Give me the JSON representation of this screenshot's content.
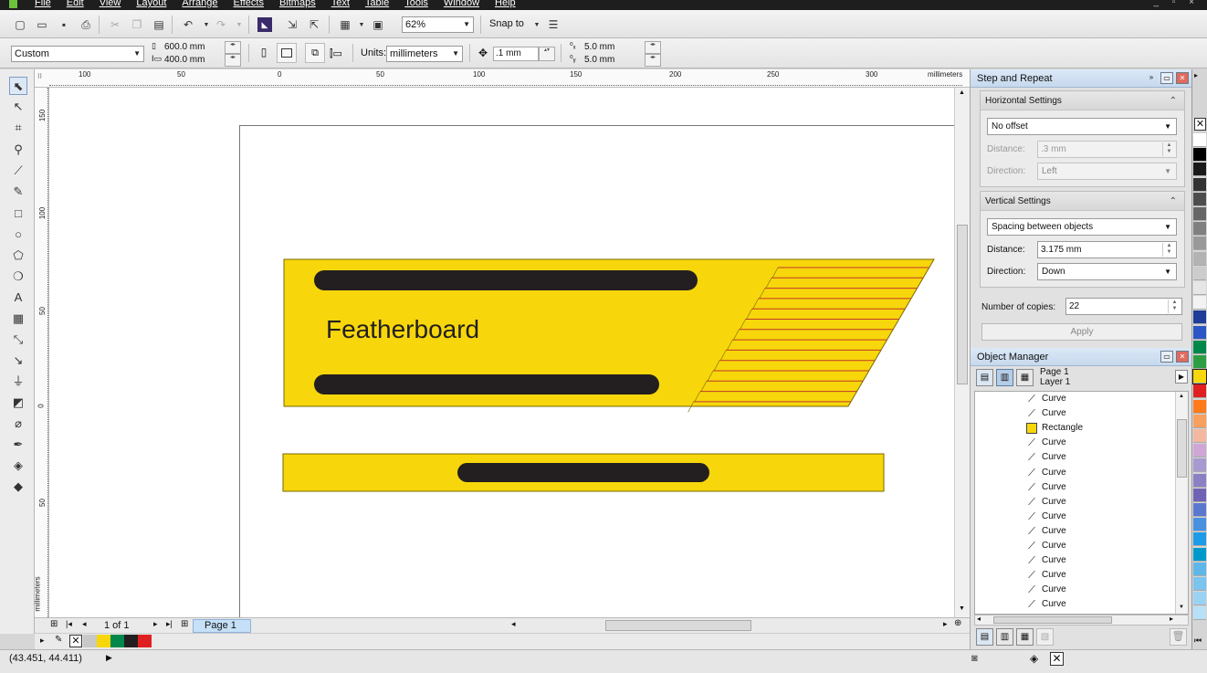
{
  "menu": {
    "items": [
      "File",
      "Edit",
      "View",
      "Layout",
      "Arrange",
      "Effects",
      "Bitmaps",
      "Text",
      "Table",
      "Tools",
      "Window",
      "Help"
    ],
    "window_controls": "_ ▫ ×"
  },
  "toolbar": {
    "zoom_value": "62%",
    "snap_to_label": "Snap to"
  },
  "propbar": {
    "page_preset": "Custom",
    "page_width": "600.0 mm",
    "page_height": "400.0 mm",
    "units_label": "Units:",
    "units_value": "millimeters",
    "nudge_value": ".1 mm",
    "dup_x": "5.0 mm",
    "dup_y": "5.0 mm"
  },
  "rulers": {
    "h_labels": [
      "100",
      "50",
      "0",
      "50",
      "100",
      "150",
      "200",
      "250",
      "300",
      "millimeters"
    ],
    "v_labels": [
      "150",
      "100",
      "50",
      "0",
      "50",
      "millimeters"
    ]
  },
  "drawing": {
    "title_text": "Featherboard",
    "fill_color": "#f7d70b",
    "bar_color": "#231f20",
    "line_color": "#c0392b",
    "outline_color": "#7a6a00"
  },
  "pagebar": {
    "page_count": "1 of 1",
    "page_tab": "Page 1"
  },
  "status": {
    "coords": "(43.451, 44.411)"
  },
  "step_repeat": {
    "title": "Step and Repeat",
    "horizontal": {
      "header": "Horizontal Settings",
      "mode": "No offset",
      "distance_label": "Distance:",
      "distance_value": ".3 mm",
      "direction_label": "Direction:",
      "direction_value": "Left"
    },
    "vertical": {
      "header": "Vertical Settings",
      "mode": "Spacing between objects",
      "distance_label": "Distance:",
      "distance_value": "3.175 mm",
      "direction_label": "Direction:",
      "direction_value": "Down"
    },
    "copies_label": "Number of copies:",
    "copies_value": "22",
    "apply_label": "Apply"
  },
  "object_manager": {
    "title": "Object Manager",
    "page_label": "Page 1",
    "layer_label": "Layer 1",
    "items": [
      {
        "type": "curve",
        "label": "Curve"
      },
      {
        "type": "curve",
        "label": "Curve"
      },
      {
        "type": "rect",
        "label": "Rectangle"
      },
      {
        "type": "curve",
        "label": "Curve"
      },
      {
        "type": "curve",
        "label": "Curve"
      },
      {
        "type": "curve",
        "label": "Curve"
      },
      {
        "type": "curve",
        "label": "Curve"
      },
      {
        "type": "curve",
        "label": "Curve"
      },
      {
        "type": "curve",
        "label": "Curve"
      },
      {
        "type": "curve",
        "label": "Curve"
      },
      {
        "type": "curve",
        "label": "Curve"
      },
      {
        "type": "curve",
        "label": "Curve"
      },
      {
        "type": "curve",
        "label": "Curve"
      },
      {
        "type": "curve",
        "label": "Curve"
      },
      {
        "type": "curve",
        "label": "Curve"
      }
    ]
  },
  "palette": {
    "colors": [
      "#ffffff",
      "#000000",
      "#1a1a1a",
      "#333333",
      "#4d4d4d",
      "#666666",
      "#808080",
      "#999999",
      "#b3b3b3",
      "#cccccc",
      "#e6e6e6",
      "#f2f2f2",
      "#1f3d99",
      "#2a56c6",
      "#00884a",
      "#2e9e44",
      "#f7d70b",
      "#e02020",
      "#ff7a1a",
      "#f8a060",
      "#f4b8a0",
      "#cfa6d6",
      "#a89ad0",
      "#8c7fc4",
      "#6f63b5",
      "#5b78cf",
      "#4a90e0",
      "#1e9be6",
      "#0099cc",
      "#5fb6e8",
      "#7ac4ee",
      "#9ad3f2",
      "#b8e0f6"
    ]
  }
}
